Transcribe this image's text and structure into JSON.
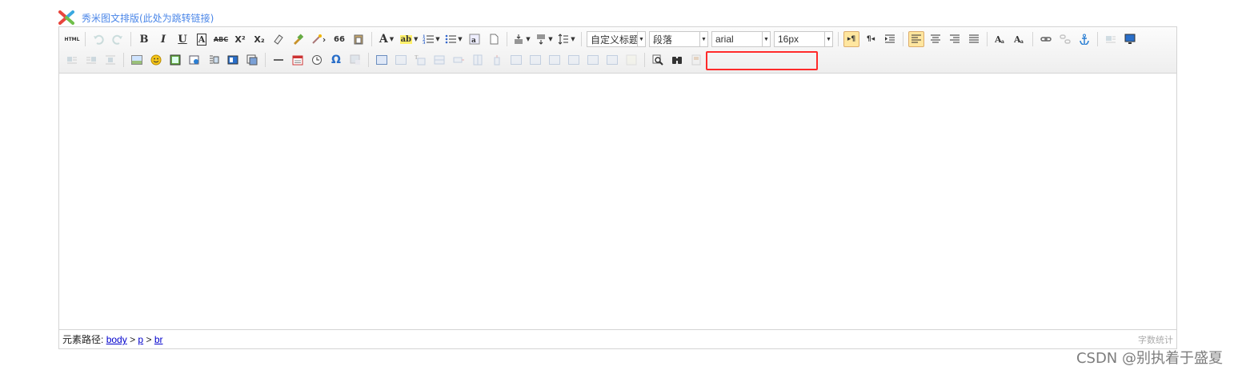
{
  "header": {
    "link_text": "秀米图文排版(此处为跳转链接)"
  },
  "toolbar": {
    "source_label": "HTML",
    "bold_label": "B",
    "italic_label": "I",
    "underline_label": "U",
    "fontborder_label": "A",
    "strike_label": "ABC",
    "superscript_label": "X²",
    "subscript_label": "X₂",
    "blockquote_label": "66",
    "forecolor_label": "A",
    "backcolor_label": "ab",
    "heading_select": "自定义标题",
    "paragraph_select": "段落",
    "fontfamily_select": "arial",
    "fontsize_select": "16px",
    "ltr_label": "▸¶",
    "rtl_label": "¶◂",
    "omega_label": "Ω"
  },
  "statusbar": {
    "path_prefix": "元素路径:",
    "path_items": [
      "body",
      "p",
      "br"
    ],
    "separator": ">",
    "word_count": "字数统计"
  },
  "watermark": "CSDN @别执着于盛夏",
  "colors": {
    "accent": "#4a86e8",
    "active_bg": "#ffe69f",
    "highlight": "#ff2a2a",
    "link": "#0000cc"
  }
}
